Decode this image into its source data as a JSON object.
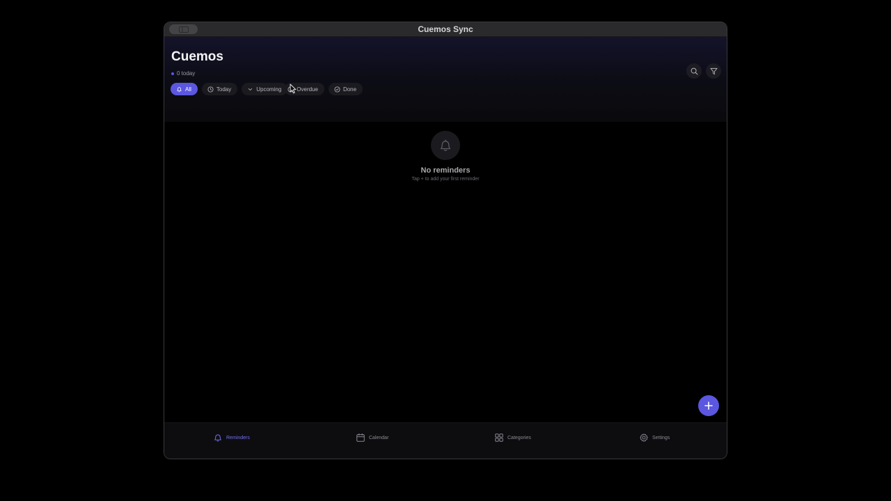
{
  "window": {
    "title": "Cuemos Sync"
  },
  "header": {
    "app_title": "Cuemos",
    "today_count": "0 today",
    "search_icon": "search-icon",
    "filter_icon": "filter-icon"
  },
  "tabs": [
    {
      "label": "All",
      "icon": "bell-icon",
      "active": true
    },
    {
      "label": "Today",
      "icon": "clock-icon",
      "active": false
    },
    {
      "label": "Upcoming",
      "icon": "chevron-down-icon",
      "active": false
    },
    {
      "label": "Overdue",
      "icon": "alert-circle-icon",
      "active": false
    },
    {
      "label": "Done",
      "icon": "check-circle-icon",
      "active": false
    }
  ],
  "empty_state": {
    "icon": "bell-icon",
    "title": "No reminders",
    "subtitle": "Tap + to add your first reminder"
  },
  "fab": {
    "icon": "plus-icon"
  },
  "bottom_nav": [
    {
      "label": "Reminders",
      "icon": "bell-icon",
      "active": true
    },
    {
      "label": "Calendar",
      "icon": "calendar-icon",
      "active": false
    },
    {
      "label": "Categories",
      "icon": "grid-icon",
      "active": false
    },
    {
      "label": "Settings",
      "icon": "gear-icon",
      "active": false
    }
  ],
  "colors": {
    "accent": "#5b57e0",
    "background": "#000000",
    "titlebar": "#2a2a2c"
  }
}
